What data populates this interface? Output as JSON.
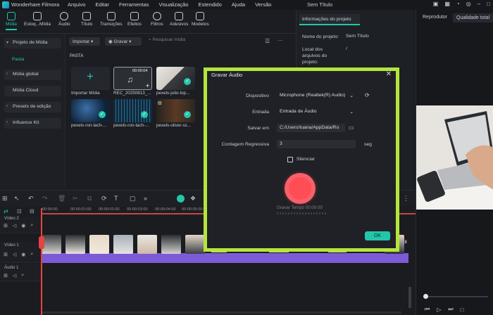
{
  "app": {
    "title": "Wonderhare Filmora",
    "document": "Sem Título"
  },
  "menu": [
    "Arquivo",
    "Editar",
    "Ferramentas",
    "Visualização",
    "Estendido",
    "Ajuda",
    "Versão"
  ],
  "toolbar": [
    {
      "label": "Mídia",
      "icon": "media-icon",
      "active": true
    },
    {
      "label": "Estoq...Mídia",
      "icon": "stock-media-icon"
    },
    {
      "label": "Áudio",
      "icon": "audio-icon"
    },
    {
      "label": "Título",
      "icon": "title-icon"
    },
    {
      "label": "Transições",
      "icon": "transitions-icon"
    },
    {
      "label": "Efeitos",
      "icon": "effects-icon"
    },
    {
      "label": "Filtros",
      "icon": "filters-icon"
    },
    {
      "label": "Adesivos",
      "icon": "stickers-icon"
    },
    {
      "label": "Modelos",
      "icon": "templates-icon"
    }
  ],
  "sidebar": {
    "items": [
      "Projeto de Mídia",
      "Mídia global",
      "Mídia Cloud",
      "Presets de edição",
      "Influence Kit"
    ],
    "sub": "Pasta"
  },
  "media": {
    "import_label": "Importar",
    "record_label": "Gravar",
    "search_placeholder": "Pesquisar mídia",
    "folder_label": "PASTA",
    "items": [
      {
        "label": "Importar Mídia"
      },
      {
        "label": "REC_20250813_...",
        "duration": "00:00:04"
      },
      {
        "label": "pexels-julio-lop..."
      },
      {
        "label": "pexels-ron-lach-..."
      },
      {
        "label": "pexels-ron-lach-..."
      },
      {
        "label": "pexels-oliver-sc..."
      }
    ]
  },
  "info": {
    "tab": "Informações do projeto",
    "name_label": "Nome do projeto:",
    "name_value": "Sem Título",
    "files_label1": "Local dos",
    "files_label2": "arquivos do",
    "files_label3": "projeto:",
    "files_value": "/"
  },
  "player": {
    "tab1": "Reprodutor",
    "tab2": "Qualidade total"
  },
  "timeline": {
    "ruler": [
      "00:00:00",
      "00:00:01:00",
      "00:00:02:00",
      "00:00:03:00",
      "00:00:04:00",
      "00:00:05:00"
    ],
    "tracks": [
      {
        "label": "Vídeo 2"
      },
      {
        "label": "Vídeo 1"
      },
      {
        "label": "Áudio 1"
      }
    ],
    "clip_end": "28"
  },
  "dialog": {
    "title": "Gravar Áudio",
    "device_label": "Dispositivo",
    "device_value": "Microphone (Realtek(R) Audio)",
    "input_label": "Entrada",
    "input_value": "Entrada de Áudio",
    "save_label": "Salvar em",
    "save_value": "C:/Users/tuana/AppData/Ro",
    "countdown_label": "Contagem Regressiva",
    "countdown_value": "3",
    "countdown_unit": "seg",
    "mute_label": "Silenciar",
    "rec_time": "Gravar Tempo 00:00:00",
    "ok": "OK"
  },
  "colors": {
    "accent": "#22c7a9",
    "frame": "#b4e53c",
    "record": "#ff4d55"
  }
}
